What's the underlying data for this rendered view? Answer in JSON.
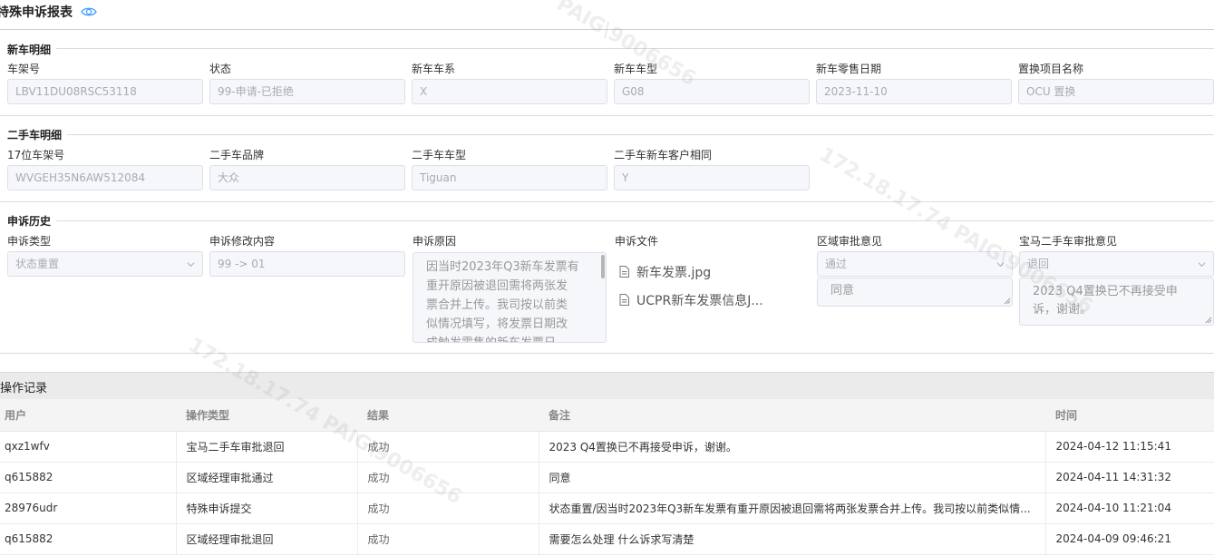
{
  "page": {
    "title": "特殊申诉报表"
  },
  "new_car": {
    "section_title": "新车明细",
    "fields": [
      {
        "label": "车架号",
        "value": "LBV11DU08RSC53118"
      },
      {
        "label": "状态",
        "value": "99-申请-已拒绝"
      },
      {
        "label": "新车车系",
        "value": "X"
      },
      {
        "label": "新车车型",
        "value": "G08"
      },
      {
        "label": "新车零售日期",
        "value": "2023-11-10"
      },
      {
        "label": "置换项目名称",
        "value": "OCU 置换"
      }
    ]
  },
  "used_car": {
    "section_title": "二手车明细",
    "fields": [
      {
        "label": "17位车架号",
        "value": "WVGEH35N6AW512084"
      },
      {
        "label": "二手车品牌",
        "value": "大众"
      },
      {
        "label": "二手车车型",
        "value": "Tiguan"
      },
      {
        "label": "二手车新车客户相同",
        "value": "Y"
      }
    ]
  },
  "appeal_history": {
    "section_title": "申诉历史",
    "appeal_type": {
      "label": "申诉类型",
      "value": "状态重置"
    },
    "modify_content": {
      "label": "申诉修改内容",
      "value": "99 -> 01"
    },
    "reason": {
      "label": "申诉原因",
      "lines": [
        "因当时2023年Q3新车发票有",
        "重开原因被退回需将两张发",
        "票合并上传。我司按以前类",
        "似情况填写，将发票日期改",
        "成触发零售的新车发票日"
      ]
    },
    "files": {
      "label": "申诉文件",
      "items": [
        "新车发票.jpg",
        "UCPR新车发票信息J..."
      ]
    },
    "region_opinion": {
      "label": "区域审批意见",
      "select_value": "通过",
      "comment": "同意"
    },
    "bmw_opinion": {
      "label": "宝马二手车审批意见",
      "select_value": "退回",
      "comment_lines": [
        "2023 Q4置换已不再接受申",
        "诉，谢谢。"
      ]
    }
  },
  "operation_log": {
    "title": "操作记录",
    "columns": [
      "用户",
      "操作类型",
      "结果",
      "备注",
      "时间"
    ],
    "rows": [
      [
        "qxz1wfv",
        "宝马二手车审批退回",
        "成功",
        "2023 Q4置换已不再接受申诉，谢谢。",
        "2024-04-12 11:15:41"
      ],
      [
        "q615882",
        "区域经理审批通过",
        "成功",
        "同意",
        "2024-04-11 14:31:32"
      ],
      [
        "28976udr",
        "特殊申诉提交",
        "成功",
        "状态重置/因当时2023年Q3新车发票有重开原因被退回需将两张发票合并上传。我司按以前类似情...",
        "2024-04-10 11:21:04"
      ],
      [
        "q615882",
        "区域经理审批退回",
        "成功",
        "需要怎么处理 什么诉求写清楚",
        "2024-04-09 09:46:21"
      ]
    ]
  },
  "watermarks": [
    "PAIG\\9006656",
    "172.18.17.74  PAIG\\9006656",
    "172.18.17.74  PAIG\\9006656"
  ],
  "colors": {
    "accent": "#409eff",
    "disabled_bg": "#f5f7fa",
    "border": "#dcdfe6",
    "header_bg": "#ebebeb"
  }
}
